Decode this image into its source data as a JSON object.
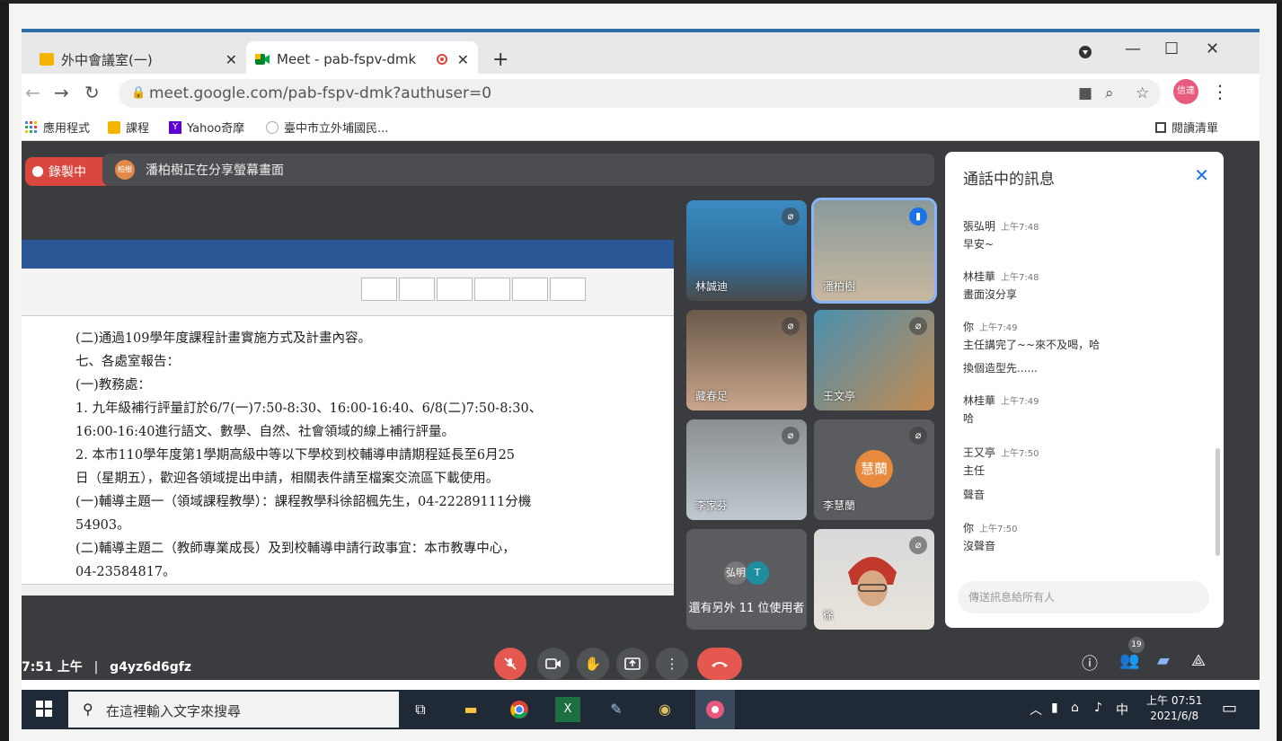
{
  "browser": {
    "tabs": [
      {
        "label": "外中會議室(一)"
      },
      {
        "label": "Meet - pab-fspv-dmk"
      }
    ],
    "new_tab": "+",
    "window": {
      "minimize": "—",
      "maximize": "☐",
      "close": "✕"
    },
    "url": "meet.google.com/pab-fspv-dmk?authuser=0",
    "profile_initials": "信達"
  },
  "bookmarks": {
    "items": [
      {
        "label": "應用程式"
      },
      {
        "label": "課程"
      },
      {
        "label": "Yahoo奇摩"
      },
      {
        "label": "臺中市立外埔國民..."
      }
    ],
    "reading_list": "閱讀清單"
  },
  "meet": {
    "recording_label": "錄製中",
    "presenter_avatar": "柏樹",
    "presenting_text": "潘柏樹正在分享螢幕畫面",
    "doc_lines": [
      "(二)通過109學年度課程計畫實施方式及計畫內容。",
      "七、各處室報告：",
      "(一)教務處：",
      "1. 九年級補行評量訂於6/7(一)7:50-8:30、16:00-16:40、6/8(二)7:50-8:30、",
      "16:00-16:40進行語文、數學、自然、社會領域的線上補行評量。",
      "2. 本市110學年度第1學期高級中等以下學校到校輔導申請期程延長至6月25",
      "日（星期五），歡迎各領域提出申請，相關表件請至檔案交流區下載使用。",
      "(一)輔導主題一（領域課程教學）：課程教學科徐韶楓先生，04-22289111分機",
      "54903。",
      "(二)輔導主題二（教師專業成長）及到校輔導申請行政事宜：本市教專中心，",
      "04-23584817。"
    ],
    "participants": [
      {
        "name": "林誠迪"
      },
      {
        "name": "潘柏樹"
      },
      {
        "name": "藏春足"
      },
      {
        "name": "王文亭"
      },
      {
        "name": "李家芬"
      },
      {
        "name": "李慧蘭",
        "avatar": "慧蘭"
      },
      {
        "name": "",
        "avatar_a": "弘明",
        "avatar_b": "T",
        "more_text": "還有另外 11 位使用者"
      },
      {
        "name": "徐"
      }
    ],
    "chat": {
      "title": "通話中的訊息",
      "messages": [
        {
          "sender": "張弘明",
          "time": "上午7:48",
          "lines": [
            "早安~"
          ]
        },
        {
          "sender": "林桂華",
          "time": "上午7:48",
          "lines": [
            "畫面沒分享"
          ]
        },
        {
          "sender": "你",
          "time": "上午7:49",
          "lines": [
            "主任講完了~~來不及喝，哈",
            "換個造型先......"
          ]
        },
        {
          "sender": "林桂華",
          "time": "上午7:49",
          "lines": [
            "哈"
          ]
        },
        {
          "sender": "王又亭",
          "time": "上午7:50",
          "lines": [
            "主任",
            "聲音"
          ]
        },
        {
          "sender": "你",
          "time": "上午7:50",
          "lines": [
            "沒聲音"
          ]
        }
      ],
      "input_placeholder": "傳送訊息給所有人"
    },
    "time": "7:51 上午",
    "meeting_code": "g4yz6d6gfz",
    "participant_count": "19"
  },
  "taskbar": {
    "search_placeholder": "在這裡輸入文字來搜尋",
    "ime": "中",
    "clock_time": "上午 07:51",
    "clock_date": "2021/6/8"
  }
}
